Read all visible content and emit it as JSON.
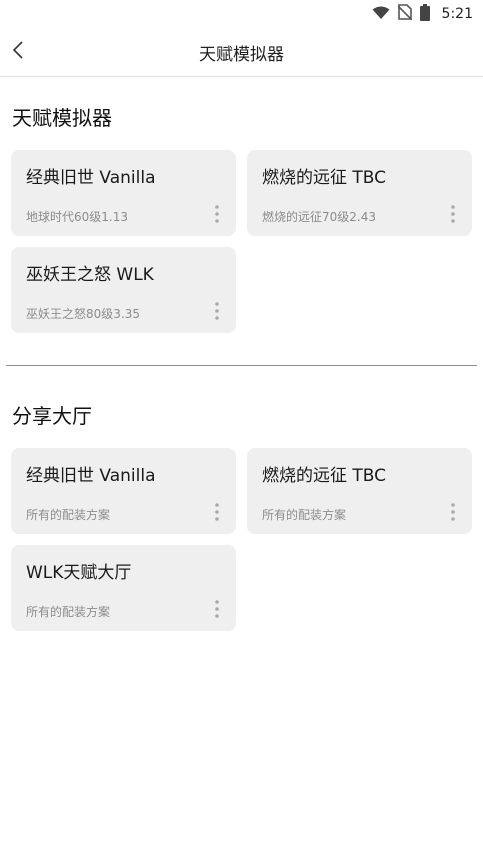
{
  "status_bar": {
    "time": "5:21"
  },
  "app_bar": {
    "title": "天赋模拟器"
  },
  "sections": [
    {
      "title": "天赋模拟器",
      "cards": [
        {
          "title": "经典旧世 Vanilla",
          "subtitle": "地球时代60级1.13"
        },
        {
          "title": "燃烧的远征 TBC",
          "subtitle": "燃烧的远征70级2.43"
        },
        {
          "title": "巫妖王之怒 WLK",
          "subtitle": "巫妖王之怒80级3.35"
        }
      ]
    },
    {
      "title": "分享大厅",
      "cards": [
        {
          "title": "经典旧世 Vanilla",
          "subtitle": "所有的配装方案"
        },
        {
          "title": "燃烧的远征 TBC",
          "subtitle": "所有的配装方案"
        },
        {
          "title": "WLK天赋大厅",
          "subtitle": "所有的配装方案"
        }
      ]
    }
  ]
}
